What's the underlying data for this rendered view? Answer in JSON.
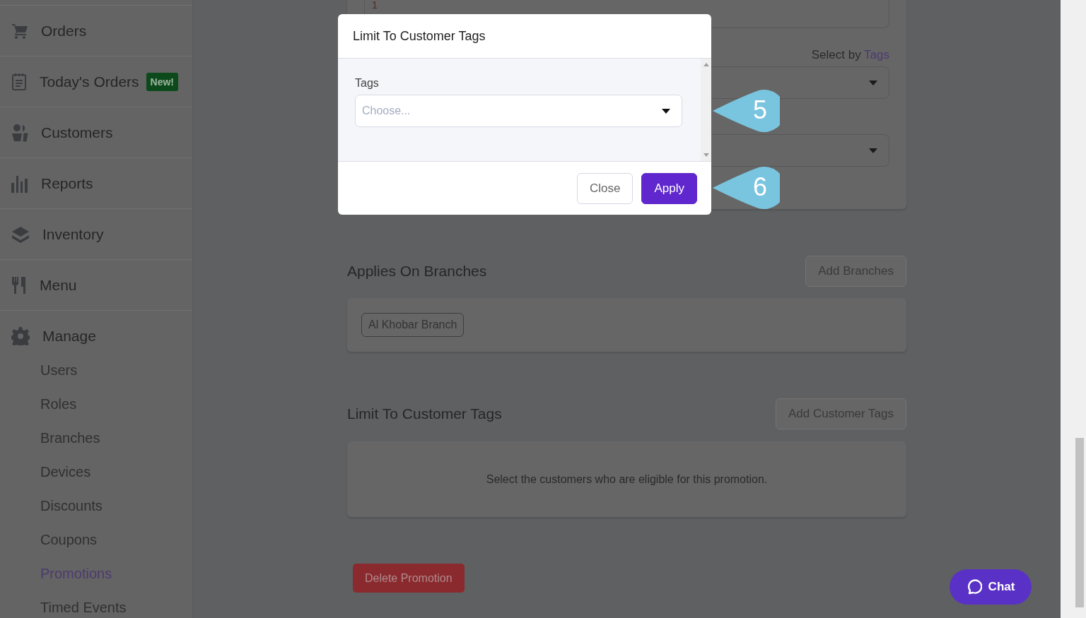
{
  "sidebar": {
    "items": [
      {
        "label": "Orders"
      },
      {
        "label": "Today's Orders",
        "badge": "New!"
      },
      {
        "label": "Customers"
      },
      {
        "label": "Reports"
      },
      {
        "label": "Inventory"
      },
      {
        "label": "Menu"
      }
    ],
    "section": {
      "label": "Manage",
      "children": [
        {
          "label": "Users",
          "selected": false
        },
        {
          "label": "Roles",
          "selected": false
        },
        {
          "label": "Branches",
          "selected": false
        },
        {
          "label": "Devices",
          "selected": false
        },
        {
          "label": "Discounts",
          "selected": false
        },
        {
          "label": "Coupons",
          "selected": false
        },
        {
          "label": "Promotions",
          "selected": true
        },
        {
          "label": "Timed Events",
          "selected": false
        }
      ]
    }
  },
  "conditions_card": {
    "field_value": "1",
    "select_by_prefix": "Select by",
    "select_by_link": "Tags"
  },
  "branches": {
    "title": "Applies On Branches",
    "button": "Add Branches",
    "chips": [
      "Al Khobar Branch"
    ]
  },
  "customer_tags": {
    "title": "Limit To Customer Tags",
    "button": "Add Customer Tags",
    "empty_text": "Select the customers who are eligible for this promotion."
  },
  "delete_button": "Delete Promotion",
  "modal": {
    "title": "Limit To Customer Tags",
    "field_label": "Tags",
    "placeholder": "Choose...",
    "buttons": [
      {
        "label": "Close",
        "kind": "secondary"
      },
      {
        "label": "Apply",
        "kind": "primary"
      }
    ]
  },
  "callouts": [
    "5",
    "6"
  ],
  "chat_button": "Chat"
}
